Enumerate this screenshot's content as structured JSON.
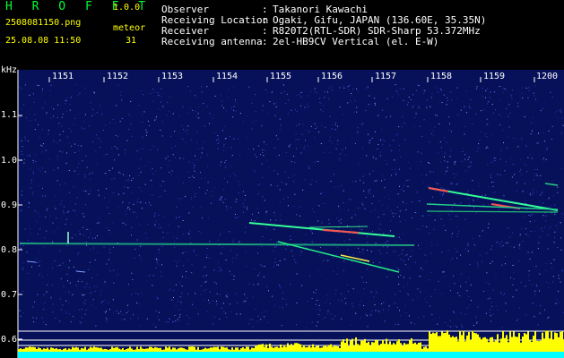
{
  "header": {
    "logo": "H R O F F T",
    "version": "1.0.0",
    "filename": "2508081150.png",
    "timestamp": "25.08.08 11:50",
    "meteor_label": "meteor",
    "meteor_count": "31"
  },
  "info": [
    {
      "key": "Observer",
      "value": "Takanori Kawachi"
    },
    {
      "key": "Receiving Location",
      "value": "Ogaki, Gifu, JAPAN (136.60E, 35.35N)"
    },
    {
      "key": "Receiver",
      "value": "R820T2(RTL-SDR) SDR-Sharp 53.372MHz"
    },
    {
      "key": "Receiving antenna",
      "value": "2el-HB9CV Vertical (el. E-W)"
    }
  ],
  "plot": {
    "y_unit": "kHz",
    "y_ticks": [
      "1.1",
      "1.0",
      "0.9",
      "0.8",
      "0.7",
      "0.6"
    ],
    "time_ticks": [
      "1151",
      "1152",
      "1153",
      "1154",
      "1155",
      "1156",
      "1157",
      "1158",
      "1159",
      "1200"
    ],
    "colors": {
      "background": "#07115a",
      "echo": "#00ff88",
      "strong_echo": "#ff4040",
      "level": "#ffff00",
      "baseline": "#00ffff"
    }
  }
}
